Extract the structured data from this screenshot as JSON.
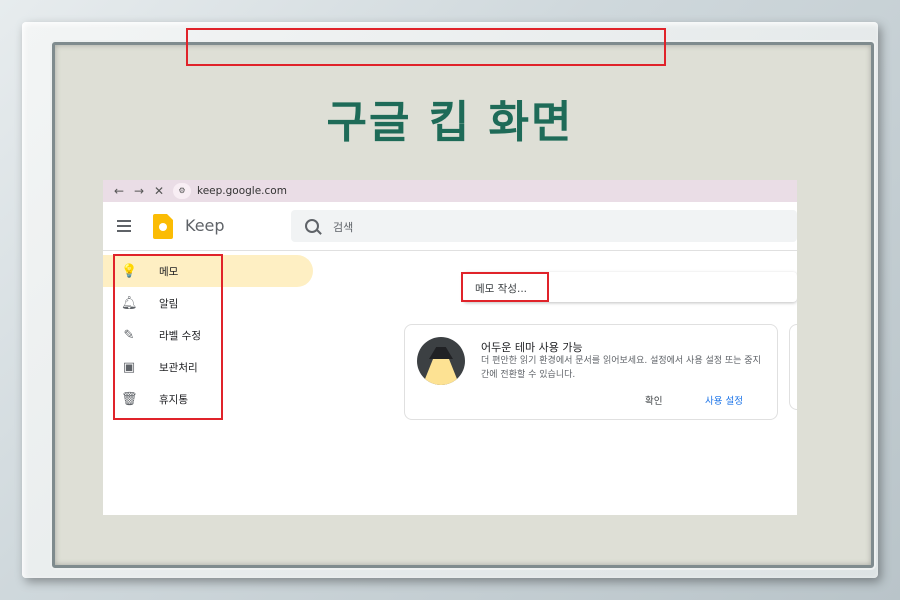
{
  "poster": {
    "title": "구글 킵 화면"
  },
  "browser": {
    "back_icon": "←",
    "forward_icon": "→",
    "close_icon": "✕",
    "site_icon": "⚙",
    "url": "keep.google.com"
  },
  "header": {
    "app_name": "Keep",
    "search_placeholder": "검색"
  },
  "sidebar": {
    "items": [
      {
        "label": "메모",
        "icon": "lightbulb-icon",
        "glyph": "♀",
        "active": true
      },
      {
        "label": "알림",
        "icon": "bell-icon",
        "glyph": "🔔",
        "active": false
      },
      {
        "label": "라벨 수정",
        "icon": "pencil-icon",
        "glyph": "✎",
        "active": false
      },
      {
        "label": "보관처리",
        "icon": "archive-icon",
        "glyph": "▣",
        "active": false
      },
      {
        "label": "휴지통",
        "icon": "trash-icon",
        "glyph": "🗑",
        "active": false
      }
    ]
  },
  "main": {
    "note_placeholder": "메모 작성...",
    "card": {
      "title": "어두운 테마 사용 가능",
      "body": "더 편안한 읽기 환경에서 문서를 읽어보세요. 설정에서 사용 설정 또는 중지 간에 전환할 수 있습니다.",
      "confirm_label": "확인",
      "enable_label": "사용 설정"
    }
  },
  "colors": {
    "title_color": "#1e6b58",
    "highlight_color": "#e0232a",
    "keep_yellow": "#fbbc04",
    "active_bg": "#feefc3",
    "link_blue": "#1a73e8"
  }
}
